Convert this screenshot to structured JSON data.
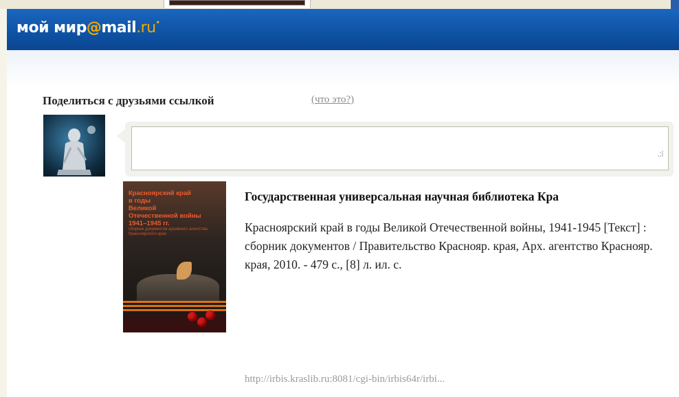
{
  "logo": {
    "part1": "мой мир",
    "at": "@",
    "part2": "mail",
    "part3": ".ru",
    "dot": "•"
  },
  "share": {
    "title": "Поделиться с друзьями ссылкой",
    "what_is": "(что это?)",
    "comment_value": "",
    "resize_glyph": ".:⁞"
  },
  "link_preview": {
    "title": "Государственная универсальная научная библиотека Кра",
    "description": "Красноярский край в годы Великой Отечественной войны, 1941-1945 [Текст] : сборник документов / Правительство Краснояр. края, Арх. агентство Краснояр. края, 2010. - 479 с., [8] л. ил. с.",
    "url": "http://irbis.kraslib.ru:8081/cgi-bin/irbis64r/irbi..."
  },
  "book_cover": {
    "lines": [
      "Красноярский край",
      "в годы",
      "Великой",
      "Отечественной войны",
      "1941–1945 гг."
    ],
    "subtitle": "сборник документов архивного агентства Красноярского края"
  },
  "colors": {
    "header_blue": "#0d4f9f",
    "accent_orange": "#f6a800"
  }
}
